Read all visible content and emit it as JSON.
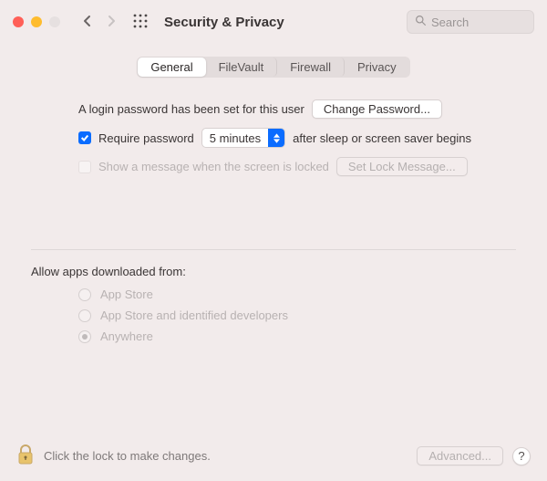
{
  "window": {
    "title": "Security & Privacy",
    "search_placeholder": "Search"
  },
  "tabs": [
    {
      "label": "General",
      "active": true
    },
    {
      "label": "FileVault",
      "active": false
    },
    {
      "label": "Firewall",
      "active": false
    },
    {
      "label": "Privacy",
      "active": false
    }
  ],
  "login": {
    "password_set_text": "A login password has been set for this user",
    "change_password_btn": "Change Password...",
    "require_password_label": "Require password",
    "require_password_delay": "5 minutes",
    "require_password_suffix": "after sleep or screen saver begins",
    "show_message_label": "Show a message when the screen is locked",
    "set_lock_message_btn": "Set Lock Message..."
  },
  "downloads": {
    "section_label": "Allow apps downloaded from:",
    "options": [
      {
        "label": "App Store",
        "selected": false
      },
      {
        "label": "App Store and identified developers",
        "selected": false
      },
      {
        "label": "Anywhere",
        "selected": true
      }
    ]
  },
  "footer": {
    "lock_text": "Click the lock to make changes.",
    "advanced_btn": "Advanced...",
    "help_label": "?"
  }
}
